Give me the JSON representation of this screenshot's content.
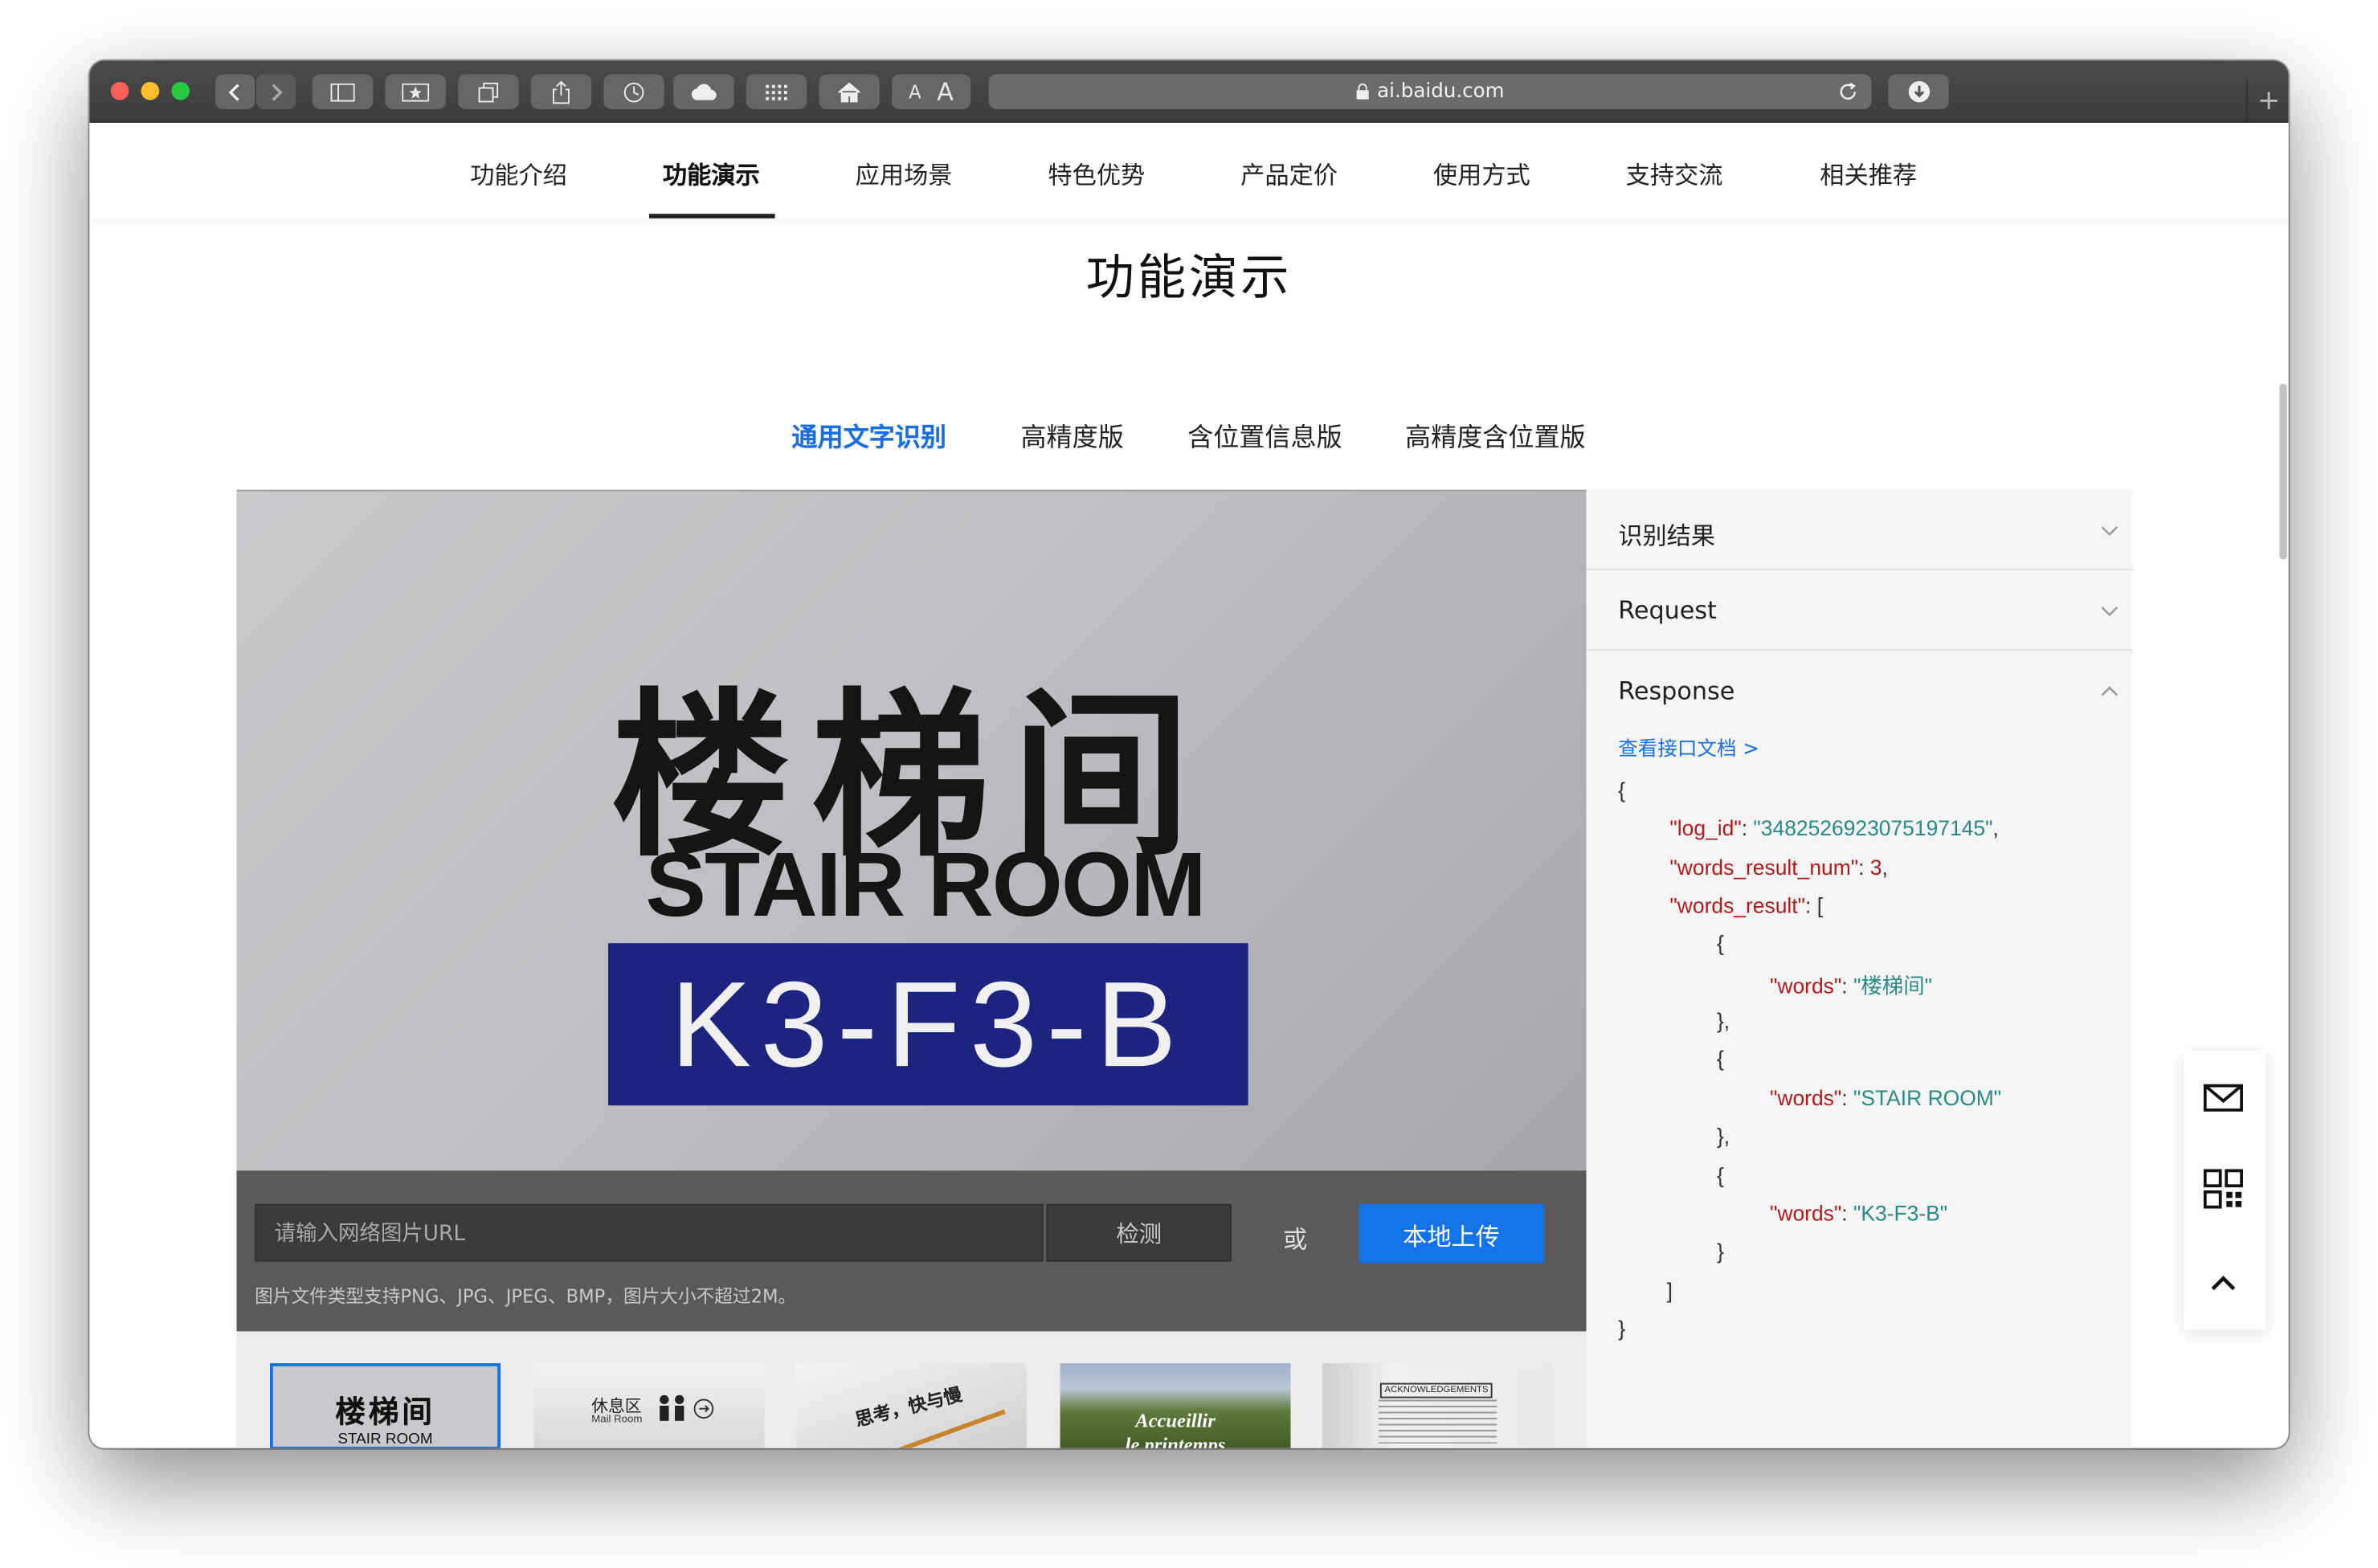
{
  "browser": {
    "url": "ai.baidu.com",
    "text_size_small": "A",
    "text_size_large": "A"
  },
  "nav": {
    "items": [
      {
        "label": "功能介绍"
      },
      {
        "label": "功能演示"
      },
      {
        "label": "应用场景"
      },
      {
        "label": "特色优势"
      },
      {
        "label": "产品定价"
      },
      {
        "label": "使用方式"
      },
      {
        "label": "支持交流"
      },
      {
        "label": "相关推荐"
      }
    ],
    "active": "功能演示"
  },
  "section_title": "功能演示",
  "demo_tabs": {
    "items": [
      {
        "label": "通用文字识别"
      },
      {
        "label": "高精度版"
      },
      {
        "label": "含位置信息版"
      },
      {
        "label": "高精度含位置版"
      }
    ],
    "active": "通用文字识别"
  },
  "demo_image": {
    "line1": "楼梯间",
    "line2": "STAIR ROOM",
    "line3": "K3-F3-B",
    "plate_color": "#1c2480"
  },
  "upload": {
    "url_placeholder": "请输入网络图片URL",
    "detect_label": "检测",
    "or_label": "或",
    "local_upload_label": "本地上传",
    "hint": "图片文件类型支持PNG、JPG、JPEG、BMP，图片大小不超过2M。"
  },
  "thumbnails": [
    {
      "line1": "楼梯间",
      "line2": "STAIR ROOM",
      "selected": true
    },
    {
      "line1": "休息区",
      "line2": "Mail Room",
      "selected": false
    },
    {
      "line1": "思考，快与慢",
      "selected": false
    },
    {
      "line1": "Accueillir",
      "line2": "le printemps",
      "selected": false
    },
    {
      "line1": "ACKNOWLEDGEMENTS",
      "selected": false
    }
  ],
  "result_panel": {
    "section_result": "识别结果",
    "section_request": "Request",
    "section_response": "Response",
    "doc_link": "查看接口文档 >",
    "response": {
      "log_id_key": "\"log_id\"",
      "log_id_value": "\"3482526923075197145\"",
      "num_key": "\"words_result_num\"",
      "num_value": "3",
      "result_key": "\"words_result\"",
      "words_key": "\"words\"",
      "words": [
        "\"楼梯间\"",
        "\"STAIR ROOM\"",
        "\"K3-F3-B\""
      ]
    }
  },
  "colors": {
    "accent": "#1473e6",
    "link": "#1a6fe0",
    "json_key": "#b01b1b",
    "json_string": "#2a8a86"
  },
  "floating_tools": [
    "mail-icon",
    "qrcode-icon",
    "back-to-top-icon"
  ]
}
